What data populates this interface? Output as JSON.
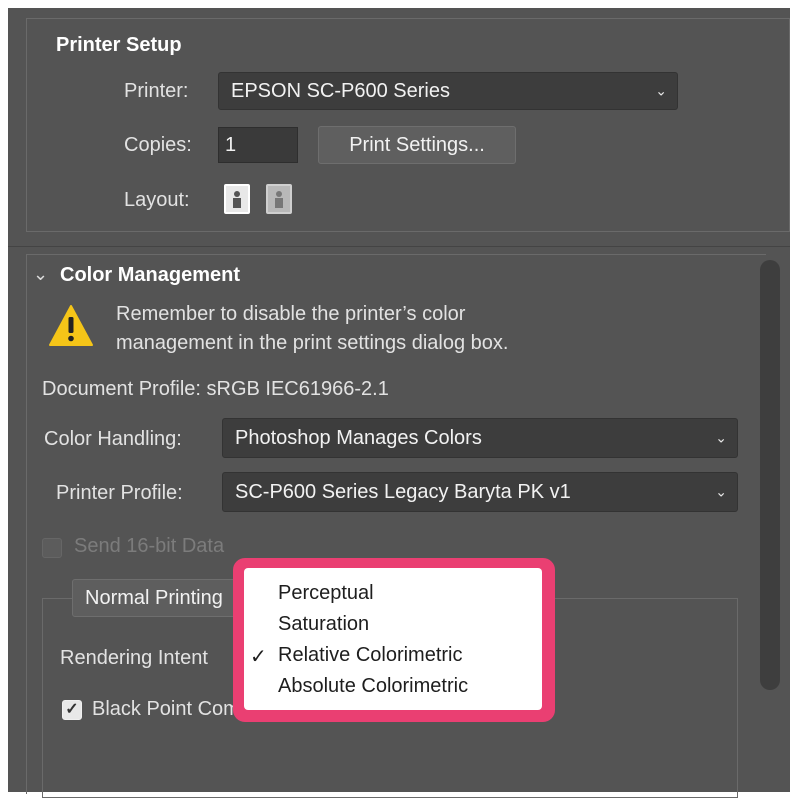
{
  "printer_setup": {
    "title": "Printer Setup",
    "printer_label": "Printer:",
    "printer_value": "EPSON SC-P600 Series",
    "copies_label": "Copies:",
    "copies_value": "1",
    "print_settings_button": "Print Settings...",
    "layout_label": "Layout:",
    "layout_icons": [
      "portrait-icon",
      "landscape-icon"
    ]
  },
  "color_management": {
    "title": "Color Management",
    "warning_line1": "Remember to disable the printer’s color",
    "warning_line2": "management in the print settings dialog box.",
    "document_profile": "Document Profile: sRGB IEC61966-2.1",
    "color_handling_label": "Color Handling:",
    "color_handling_value": "Photoshop Manages Colors",
    "printer_profile_label": "Printer Profile:",
    "printer_profile_value": "SC-P600 Series Legacy Baryta PK v1",
    "send_16bit_label": "Send 16-bit Data",
    "tab_label": "Normal Printing",
    "rendering_intent_label": "Rendering Intent",
    "black_point_label": "Black Point Compensation"
  },
  "rendering_intent_menu": {
    "options": [
      "Perceptual",
      "Saturation",
      "Relative Colorimetric",
      "Absolute Colorimetric"
    ],
    "selected": "Relative Colorimetric",
    "check_glyph": "✓"
  },
  "colors": {
    "panel_bg": "#545454",
    "highlight": "#ea3f72",
    "warning": "#f5c518"
  }
}
